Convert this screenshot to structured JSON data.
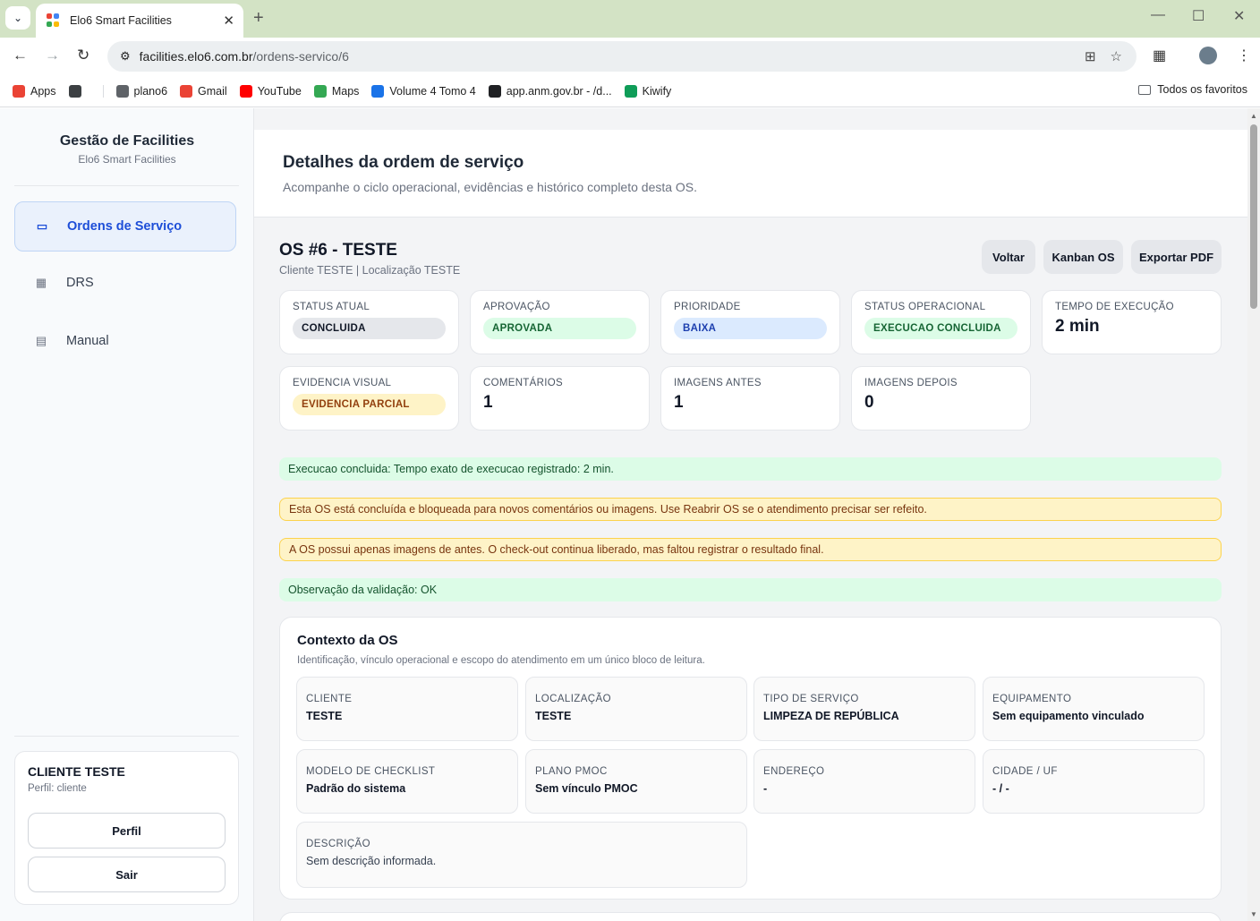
{
  "browser": {
    "tab_title": "Elo6 Smart Facilities",
    "url_host": "facilities.elo6.com.br",
    "url_path": "/ordens-servico/6",
    "bookmarks": [
      {
        "label": "Apps",
        "color": "#ea4335"
      },
      {
        "label": "",
        "color": "#3c4043"
      },
      {
        "label": "plano6",
        "color": "#5f6368"
      },
      {
        "label": "Gmail",
        "color": "#ea4335"
      },
      {
        "label": "YouTube",
        "color": "#ff0000"
      },
      {
        "label": "Maps",
        "color": "#34a853"
      },
      {
        "label": "Volume 4 Tomo 4",
        "color": "#1a73e8"
      },
      {
        "label": "app.anm.gov.br - /d...",
        "color": "#202124"
      },
      {
        "label": "Kiwify",
        "color": "#0f9d58"
      }
    ],
    "all_bookmarks": "Todos os favoritos"
  },
  "sidebar": {
    "app_title": "Gestão de Facilities",
    "app_subtitle": "Elo6 Smart Facilities",
    "items": [
      {
        "label": "Ordens de Serviço",
        "icon": "clipboard-icon",
        "active": true
      },
      {
        "label": "DRS",
        "icon": "calendar-icon",
        "active": false
      },
      {
        "label": "Manual",
        "icon": "document-icon",
        "active": false
      }
    ],
    "user": {
      "name": "CLIENTE TESTE",
      "role": "Perfil: cliente",
      "profile_button": "Perfil",
      "logout_button": "Sair"
    }
  },
  "header": {
    "title": "Detalhes da ordem de serviço",
    "subtitle": "Acompanhe o ciclo operacional, evidências e histórico completo desta OS."
  },
  "os": {
    "title": "OS #6 - TESTE",
    "subtitle": "Cliente TESTE | Localização TESTE",
    "actions": {
      "back": "Voltar",
      "kanban": "Kanban OS",
      "export": "Exportar PDF"
    }
  },
  "stats": [
    {
      "label": "STATUS ATUAL",
      "value": "CONCLUIDA",
      "kind": "pill",
      "bg": "#e5e7eb",
      "fg": "#111827"
    },
    {
      "label": "APROVAÇÃO",
      "value": "APROVADA",
      "kind": "pill",
      "bg": "#dcfce7",
      "fg": "#166534"
    },
    {
      "label": "PRIORIDADE",
      "value": "BAIXA",
      "kind": "pill",
      "bg": "#dbeafe",
      "fg": "#1e40af"
    },
    {
      "label": "STATUS OPERACIONAL",
      "value": "EXECUCAO CONCLUIDA",
      "kind": "pill",
      "bg": "#dcfce7",
      "fg": "#166534"
    },
    {
      "label": "TEMPO DE EXECUÇÃO",
      "value": "2 min",
      "kind": "big"
    },
    {
      "label": "EVIDENCIA VISUAL",
      "value": "EVIDENCIA PARCIAL",
      "kind": "pill",
      "bg": "#fef3c7",
      "fg": "#92400e"
    },
    {
      "label": "COMENTÁRIOS",
      "value": "1",
      "kind": "big"
    },
    {
      "label": "IMAGENS ANTES",
      "value": "1",
      "kind": "big"
    },
    {
      "label": "IMAGENS DEPOIS",
      "value": "0",
      "kind": "big"
    }
  ],
  "alerts": [
    {
      "text": "Execucao concluida: Tempo exato de execucao registrado: 2 min.",
      "kind": "ok"
    },
    {
      "text": "Esta OS está concluída e bloqueada para novos comentários ou imagens. Use Reabrir OS se o atendimento precisar ser refeito.",
      "kind": "warn"
    },
    {
      "text": "A OS possui apenas imagens de antes. O check-out continua liberado, mas faltou registrar o resultado final.",
      "kind": "warn"
    },
    {
      "text": "Observação da validação: OK",
      "kind": "ok"
    }
  ],
  "context": {
    "title": "Contexto da OS",
    "description": "Identificação, vínculo operacional e escopo do atendimento em um único bloco de leitura.",
    "fields": [
      {
        "label": "CLIENTE",
        "value": "TESTE"
      },
      {
        "label": "LOCALIZAÇÃO",
        "value": "TESTE"
      },
      {
        "label": "TIPO DE SERVIÇO",
        "value": "LIMPEZA DE REPÚBLICA"
      },
      {
        "label": "EQUIPAMENTO",
        "value": "Sem equipamento vinculado"
      },
      {
        "label": "MODELO DE CHECKLIST",
        "value": "Padrão do sistema"
      },
      {
        "label": "PLANO PMOC",
        "value": "Sem vínculo PMOC"
      },
      {
        "label": "ENDEREÇO",
        "value": "-"
      },
      {
        "label": "CIDADE / UF",
        "value": "- / -"
      },
      {
        "label": "DESCRIÇÃO",
        "value": "Sem descrição informada."
      }
    ]
  }
}
